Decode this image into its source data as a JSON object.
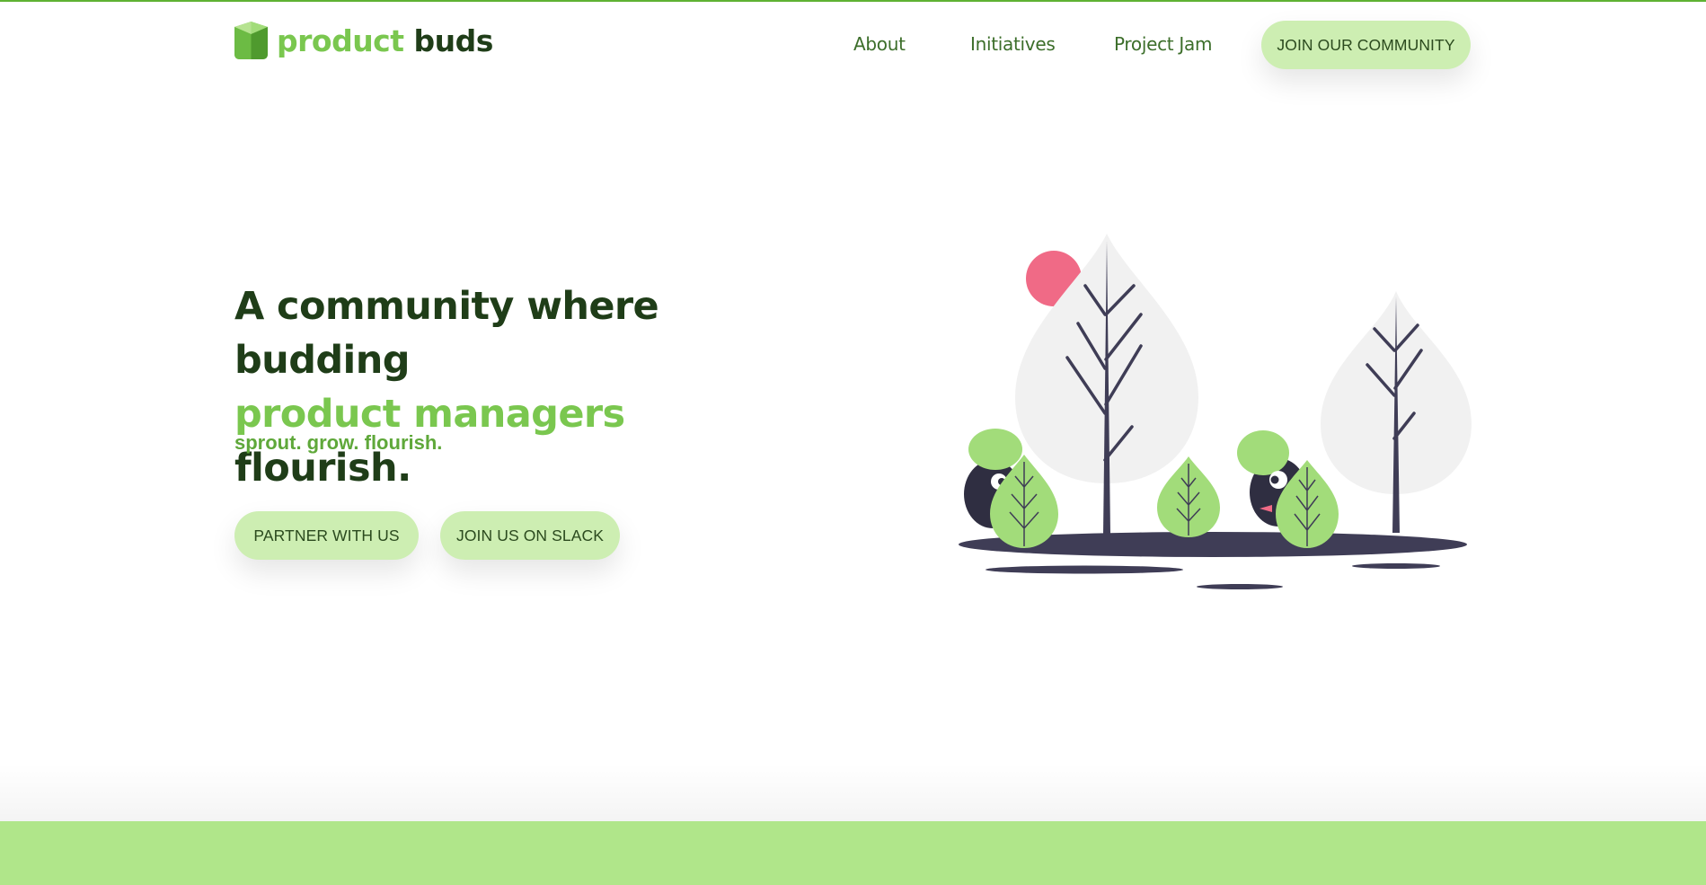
{
  "brand": {
    "name_part1": "product",
    "name_part2": "buds",
    "icon": "leaf-box-logo-icon"
  },
  "nav": {
    "links": [
      {
        "label": "About"
      },
      {
        "label": "Initiatives"
      },
      {
        "label": "Project Jam"
      }
    ],
    "cta_label": "JOIN OUR COMMUNITY"
  },
  "hero": {
    "headline_part1": "A community where budding",
    "headline_highlight": "product managers",
    "headline_part2": "flourish.",
    "tagline": "sprout. grow. flourish.",
    "buttons": [
      {
        "label": "PARTNER WITH US"
      },
      {
        "label": "JOIN US ON SLACK"
      }
    ]
  },
  "illustration": {
    "name": "trees-with-hiding-creatures-illustration",
    "icons": [
      "sun-icon",
      "tree-icon",
      "bush-icon",
      "creature-icon"
    ]
  },
  "colors": {
    "brand_green": "#7ac74f",
    "dark_green": "#1f3d18",
    "pale_green": "#cdeeb2",
    "band_green": "#b0e68a",
    "top_border": "#5fb233",
    "tree_grey": "#f1f1f1",
    "trunk": "#3f3d56",
    "sun_pink": "#f06a86",
    "leaf_green": "#a2dc7a"
  }
}
